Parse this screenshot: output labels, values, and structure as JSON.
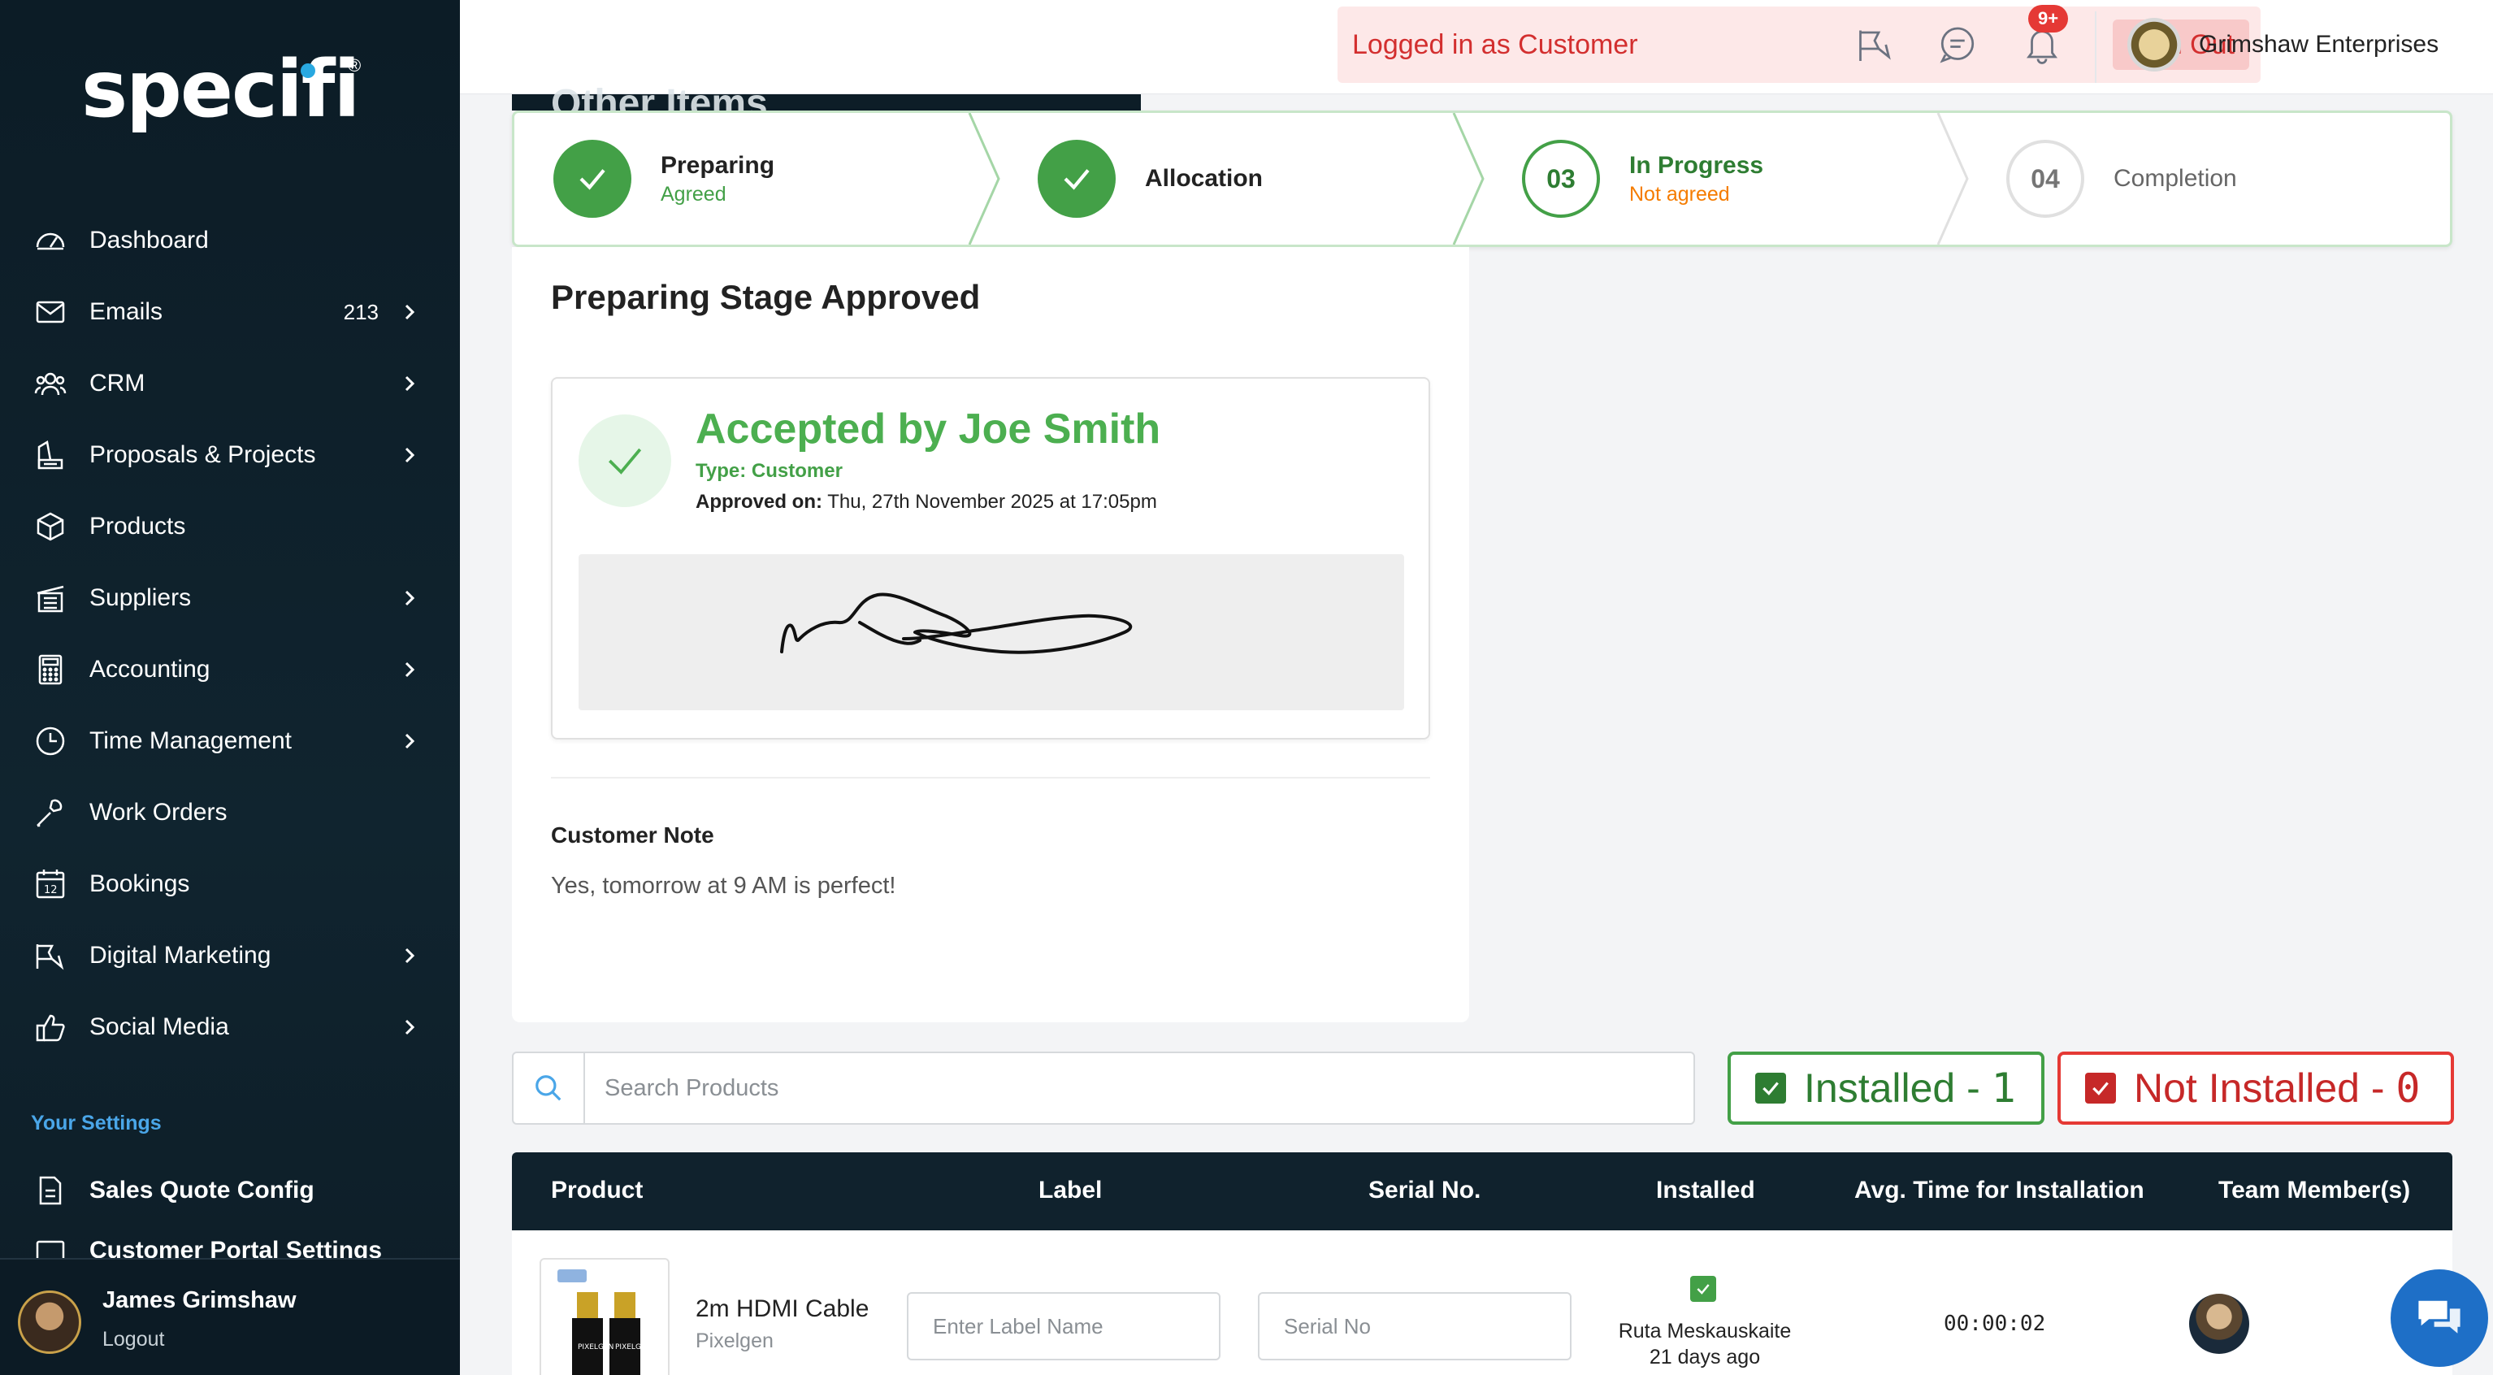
{
  "brand": {
    "logo_text": "specifi"
  },
  "sidebar": {
    "items": [
      {
        "label": "Dashboard",
        "icon": "dashboard-icon",
        "has_chevron": false
      },
      {
        "label": "Emails",
        "icon": "mail-icon",
        "count": "213",
        "has_chevron": true
      },
      {
        "label": "CRM",
        "icon": "users-icon",
        "has_chevron": true
      },
      {
        "label": "Proposals & Projects",
        "icon": "proposals-icon",
        "has_chevron": true
      },
      {
        "label": "Products",
        "icon": "box-icon",
        "has_chevron": false
      },
      {
        "label": "Suppliers",
        "icon": "warehouse-icon",
        "has_chevron": true
      },
      {
        "label": "Accounting",
        "icon": "calculator-icon",
        "has_chevron": true
      },
      {
        "label": "Time Management",
        "icon": "clock-icon",
        "has_chevron": true
      },
      {
        "label": "Work Orders",
        "icon": "wrench-icon",
        "has_chevron": false
      },
      {
        "label": "Bookings",
        "icon": "calendar-icon",
        "has_chevron": false
      },
      {
        "label": "Digital Marketing",
        "icon": "megaphone-icon",
        "has_chevron": true
      },
      {
        "label": "Social Media",
        "icon": "thumbs-up-icon",
        "has_chevron": true
      }
    ],
    "settings_title": "Your Settings",
    "settings_items": [
      {
        "label": "Sales Quote Config",
        "icon": "document-icon"
      },
      {
        "label": "Customer Portal Settings",
        "icon": "portal-icon"
      }
    ],
    "user": {
      "name": "James Grimshaw",
      "logout": "Logout"
    }
  },
  "topbar": {
    "login_status": "Logged in as Customer",
    "sign_out": "Sign Out",
    "notification_badge": "9+",
    "company": "Grimshaw Enterprises"
  },
  "background_header": "Other Items",
  "stepper": [
    {
      "title": "Preparing",
      "sub": "Agreed",
      "state": "done",
      "number": ""
    },
    {
      "title": "Allocation",
      "sub": "",
      "state": "done",
      "number": ""
    },
    {
      "title": "In Progress",
      "sub": "Not agreed",
      "state": "active",
      "number": "03"
    },
    {
      "title": "Completion",
      "sub": "",
      "state": "todo",
      "number": "04"
    }
  ],
  "approval": {
    "heading": "Preparing Stage Approved",
    "accepted_by": "Accepted by Joe Smith",
    "type": "Type: Customer",
    "approved_label": "Approved on:",
    "approved_value": "Thu, 27th November 2025 at 17:05pm",
    "note_title": "Customer Note",
    "note_text": "Yes, tomorrow at 9 AM is perfect!"
  },
  "search": {
    "placeholder": "Search Products",
    "value": ""
  },
  "filters": {
    "installed_label": "Installed - ",
    "installed_count": "1",
    "not_installed_label": "Not Installed - ",
    "not_installed_count": "0"
  },
  "table": {
    "headers": [
      "Product",
      "Label",
      "Serial No.",
      "Installed",
      "Avg. Time for Installation",
      "Team Member(s)"
    ],
    "rows": [
      {
        "product": "2m HDMI Cable",
        "brand": "Pixelgen",
        "label_placeholder": "Enter Label Name",
        "serial_placeholder": "Serial No",
        "installed": true,
        "installed_by": "Ruta Meskauskaite",
        "installed_ago": "21 days ago",
        "avg_time": "00:00:02"
      }
    ]
  },
  "colors": {
    "sidebar_bg": "#0c1c26",
    "success": "#43a047",
    "danger": "#e53935",
    "accent": "#4aa6e8",
    "table_header": "#10222d"
  }
}
